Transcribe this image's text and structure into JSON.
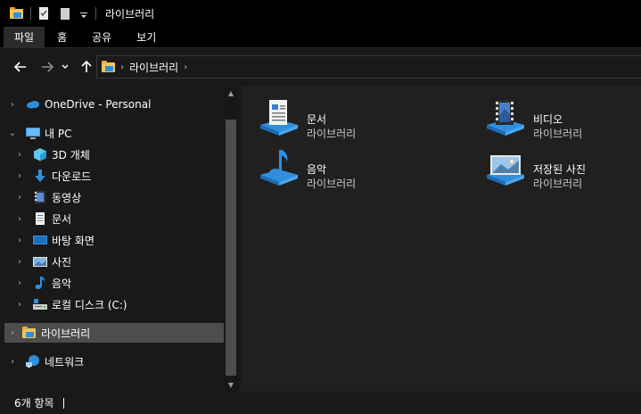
{
  "window": {
    "title": "라이브러리"
  },
  "ribbon": {
    "tabs": [
      {
        "label": "파일"
      },
      {
        "label": "홈"
      },
      {
        "label": "공유"
      },
      {
        "label": "보기"
      }
    ]
  },
  "address": {
    "crumbs": [
      {
        "label": "라이브러리"
      }
    ]
  },
  "nav": {
    "items": [
      {
        "label": "OneDrive - Personal",
        "icon": "cloud-icon"
      },
      {
        "label": "내 PC",
        "icon": "computer-icon"
      },
      {
        "label": "3D 개체",
        "icon": "cube-icon"
      },
      {
        "label": "다운로드",
        "icon": "download-icon"
      },
      {
        "label": "동영상",
        "icon": "video-icon"
      },
      {
        "label": "문서",
        "icon": "document-icon"
      },
      {
        "label": "바탕 화면",
        "icon": "desktop-icon"
      },
      {
        "label": "사진",
        "icon": "picture-icon"
      },
      {
        "label": "음악",
        "icon": "music-icon"
      },
      {
        "label": "로컬 디스크 (C:)",
        "icon": "disk-icon"
      },
      {
        "label": "라이브러리",
        "icon": "library-icon"
      },
      {
        "label": "네트워크",
        "icon": "network-icon"
      }
    ]
  },
  "libraries": [
    {
      "name": "문서",
      "type": "라이브러리",
      "icon": "documents-library-icon"
    },
    {
      "name": "비디오",
      "type": "라이브러리",
      "icon": "videos-library-icon"
    },
    {
      "name": "음악",
      "type": "라이브러리",
      "icon": "music-library-icon"
    },
    {
      "name": "저장된 사진",
      "type": "라이브러리",
      "icon": "saved-pictures-library-icon"
    }
  ],
  "status": {
    "item_count": "6개 항목"
  },
  "colors": {
    "accent": "#2f8fde",
    "selection": "#4d4d4d",
    "folder": "#f2c55c"
  }
}
